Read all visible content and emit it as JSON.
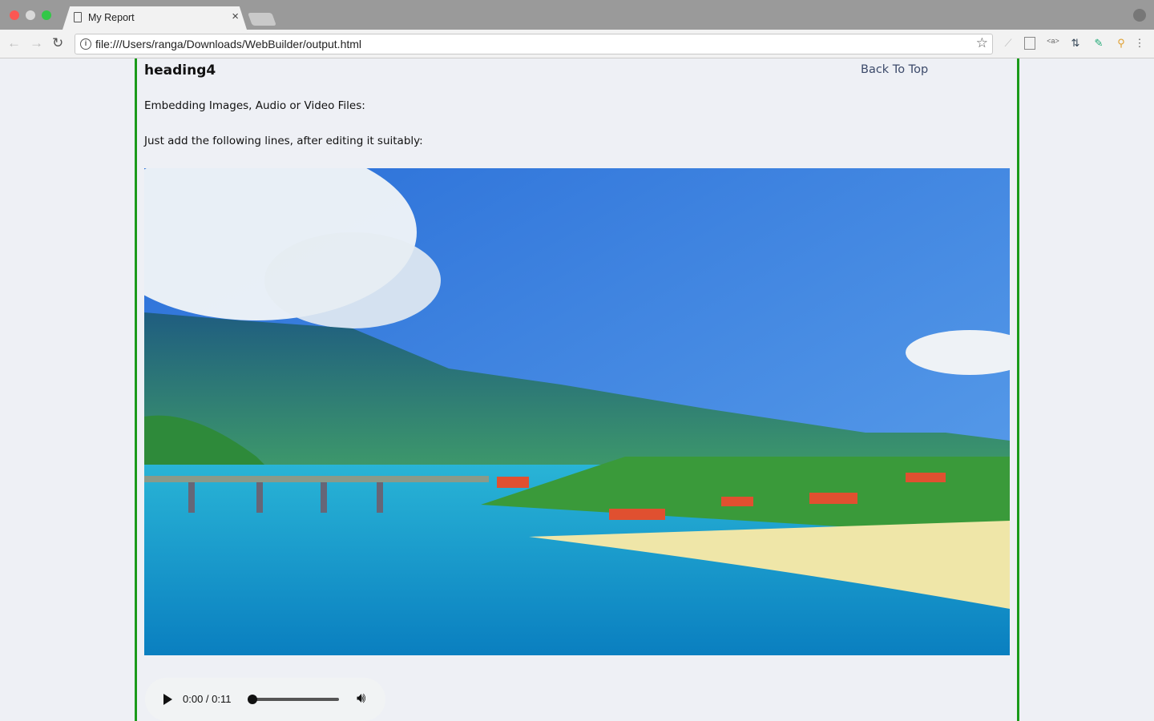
{
  "browser": {
    "tab_title": "My Report",
    "close_glyph": "×",
    "url": "file:///Users/ranga/Downloads/WebBuilder/output.html",
    "icons": [
      "back-icon",
      "forward-icon",
      "reload-icon",
      "info-icon",
      "bookmark-star-icon",
      "extension-icons",
      "menu-icon"
    ],
    "traffic_lights": {
      "close": "#fc5753",
      "minimize": "#d9d9d9",
      "maximize": "#33c748"
    }
  },
  "page": {
    "heading": "heading4",
    "back_to_top": "Back To Top",
    "para1": "Embedding Images, Audio or Video Files:",
    "para2": "Just add the following lines, after editing it suitably:",
    "border_color": "#1a9a1a"
  },
  "audio": {
    "time": "0:00 / 0:11",
    "progress": 0
  }
}
